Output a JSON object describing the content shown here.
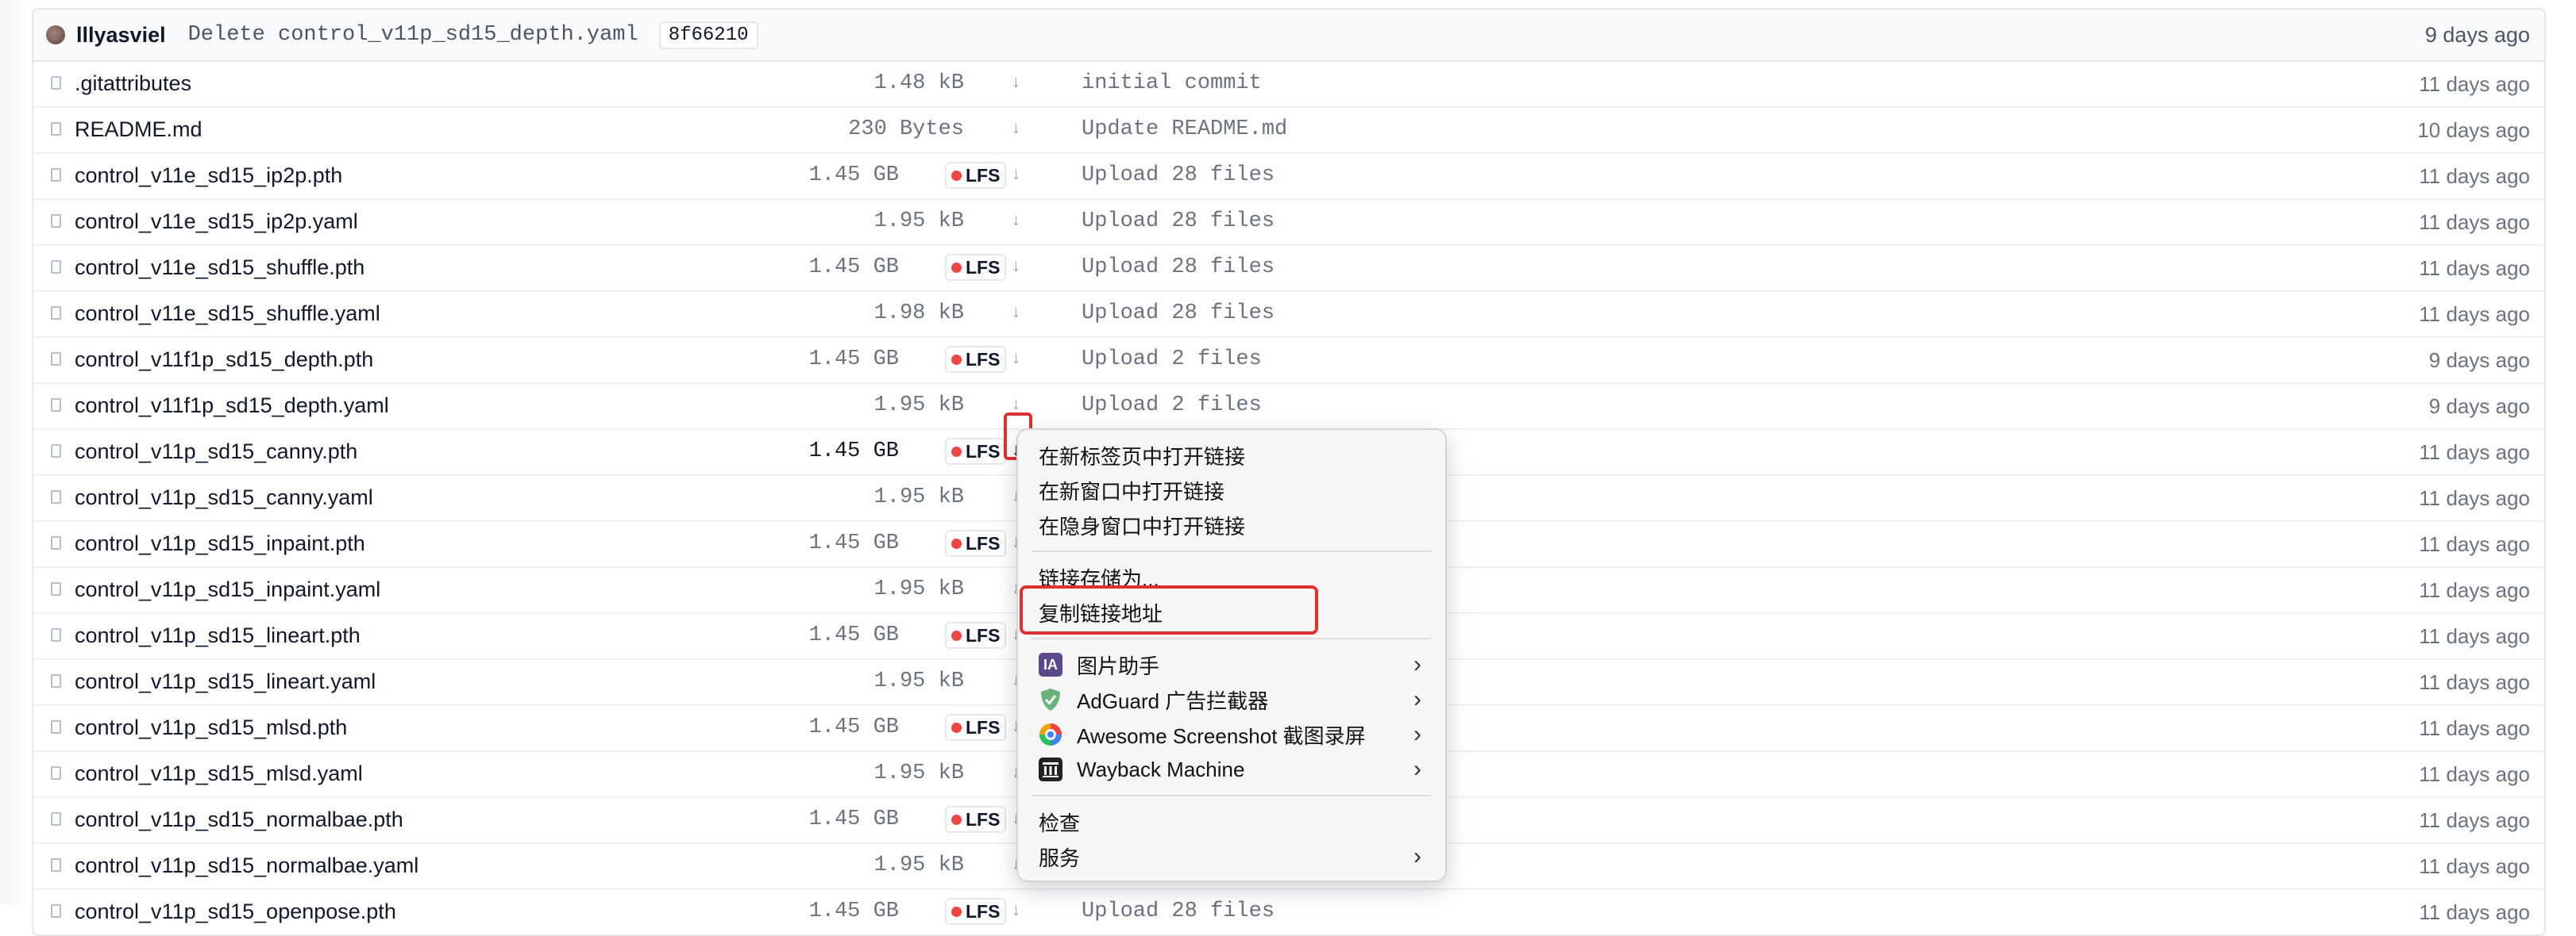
{
  "header": {
    "author": "lllyasviel",
    "commit_message": "Delete control_v11p_sd15_depth.yaml",
    "commit_hash": "8f66210",
    "date": "9 days ago"
  },
  "lfs_label": "LFS",
  "download_glyph": "↓",
  "files": [
    {
      "name": ".gitattributes",
      "size": "1.48 kB",
      "lfs": false,
      "commit": "initial commit",
      "date": "11 days ago"
    },
    {
      "name": "README.md",
      "size": "230 Bytes",
      "lfs": false,
      "commit": "Update README.md",
      "date": "10 days ago"
    },
    {
      "name": "control_v11e_sd15_ip2p.pth",
      "size": "1.45 GB",
      "lfs": true,
      "commit": "Upload 28 files",
      "date": "11 days ago"
    },
    {
      "name": "control_v11e_sd15_ip2p.yaml",
      "size": "1.95 kB",
      "lfs": false,
      "commit": "Upload 28 files",
      "date": "11 days ago"
    },
    {
      "name": "control_v11e_sd15_shuffle.pth",
      "size": "1.45 GB",
      "lfs": true,
      "commit": "Upload 28 files",
      "date": "11 days ago"
    },
    {
      "name": "control_v11e_sd15_shuffle.yaml",
      "size": "1.98 kB",
      "lfs": false,
      "commit": "Upload 28 files",
      "date": "11 days ago"
    },
    {
      "name": "control_v11f1p_sd15_depth.pth",
      "size": "1.45 GB",
      "lfs": true,
      "commit": "Upload 2 files",
      "date": "9 days ago"
    },
    {
      "name": "control_v11f1p_sd15_depth.yaml",
      "size": "1.95 kB",
      "lfs": false,
      "commit": "Upload 2 files",
      "date": "9 days ago"
    },
    {
      "name": "control_v11p_sd15_canny.pth",
      "size": "1.45 GB",
      "lfs": true,
      "commit": "",
      "date": "11 days ago",
      "active": true
    },
    {
      "name": "control_v11p_sd15_canny.yaml",
      "size": "1.95 kB",
      "lfs": false,
      "commit": "",
      "date": "11 days ago"
    },
    {
      "name": "control_v11p_sd15_inpaint.pth",
      "size": "1.45 GB",
      "lfs": true,
      "commit": "",
      "date": "11 days ago"
    },
    {
      "name": "control_v11p_sd15_inpaint.yaml",
      "size": "1.95 kB",
      "lfs": false,
      "commit": "",
      "date": "11 days ago"
    },
    {
      "name": "control_v11p_sd15_lineart.pth",
      "size": "1.45 GB",
      "lfs": true,
      "commit": "",
      "date": "11 days ago"
    },
    {
      "name": "control_v11p_sd15_lineart.yaml",
      "size": "1.95 kB",
      "lfs": false,
      "commit": "",
      "date": "11 days ago"
    },
    {
      "name": "control_v11p_sd15_mlsd.pth",
      "size": "1.45 GB",
      "lfs": true,
      "commit": "",
      "date": "11 days ago"
    },
    {
      "name": "control_v11p_sd15_mlsd.yaml",
      "size": "1.95 kB",
      "lfs": false,
      "commit": "",
      "date": "11 days ago"
    },
    {
      "name": "control_v11p_sd15_normalbae.pth",
      "size": "1.45 GB",
      "lfs": true,
      "commit": "",
      "date": "11 days ago"
    },
    {
      "name": "control_v11p_sd15_normalbae.yaml",
      "size": "1.95 kB",
      "lfs": false,
      "commit": "",
      "date": "11 days ago"
    },
    {
      "name": "control_v11p_sd15_openpose.pth",
      "size": "1.45 GB",
      "lfs": true,
      "commit": "Upload 28 files",
      "date": "11 days ago"
    }
  ],
  "context_menu": {
    "open_new_tab": "在新标签页中打开链接",
    "open_new_window": "在新窗口中打开链接",
    "open_incognito": "在隐身窗口中打开链接",
    "save_link_as": "链接存储为...",
    "copy_link": "复制链接地址",
    "ext_image_helper": "图片助手",
    "ext_image_helper_icon_text": "IA",
    "ext_adguard": "AdGuard 广告拦截器",
    "ext_awesome_screenshot": "Awesome Screenshot 截图录屏",
    "ext_wayback": "Wayback Machine",
    "inspect": "检查",
    "services": "服务",
    "submenu_chevron": "›"
  },
  "colors": {
    "lfs_dot": "#ef4444",
    "highlight_red": "#e03131",
    "adguard_green": "#67b279",
    "wayback_dark": "#222222",
    "image_helper_purple": "#5b4a8b"
  }
}
